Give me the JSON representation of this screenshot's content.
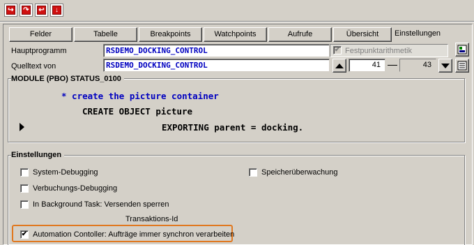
{
  "toolbar": {
    "buttons": [
      {
        "name": "single-step-icon",
        "glyph": "↪"
      },
      {
        "name": "execute-icon",
        "glyph": "↷"
      },
      {
        "name": "return-icon",
        "glyph": "↩"
      },
      {
        "name": "continue-icon",
        "glyph": "↓"
      }
    ]
  },
  "tabs": [
    {
      "label": "Felder"
    },
    {
      "label": "Tabelle"
    },
    {
      "label": "Breakpoints"
    },
    {
      "label": "Watchpoints"
    },
    {
      "label": "Aufrufe"
    },
    {
      "label": "Übersicht"
    },
    {
      "label": "Einstellungen"
    }
  ],
  "fields": {
    "hauptprogramm_label": "Hauptprogramm",
    "hauptprogramm_value": "RSDEMO_DOCKING_CONTROL",
    "quelltext_label": "Quelltext von",
    "quelltext_value": "RSDEMO_DOCKING_CONTROL",
    "festpunkt_label": "Festpunktarithmetik",
    "line_from": "41",
    "line_to": "43"
  },
  "source": {
    "header": "MODULE (PBO) STATUS_0100",
    "lines": [
      "* create the picture container",
      "CREATE OBJECT picture",
      "EXPORTING parent = docking."
    ]
  },
  "settings": {
    "title": "Einstellungen",
    "system_debugging": "System-Debugging",
    "verbuchungs_debugging": "Verbuchungs-Debugging",
    "background_task": "In Background Task: Versenden sperren",
    "speicherueberwachung": "Speicherüberwachung",
    "transaktions_id": "Transaktions-Id",
    "automation_controller": "Automation Contoller: Aufträge immer synchron verarbeiten",
    "automation_checked": "✔"
  },
  "colors": {
    "background": "#d4d0c8",
    "field_text": "#0000c0",
    "comment_text": "#0000c0",
    "highlight": "#e07820"
  }
}
